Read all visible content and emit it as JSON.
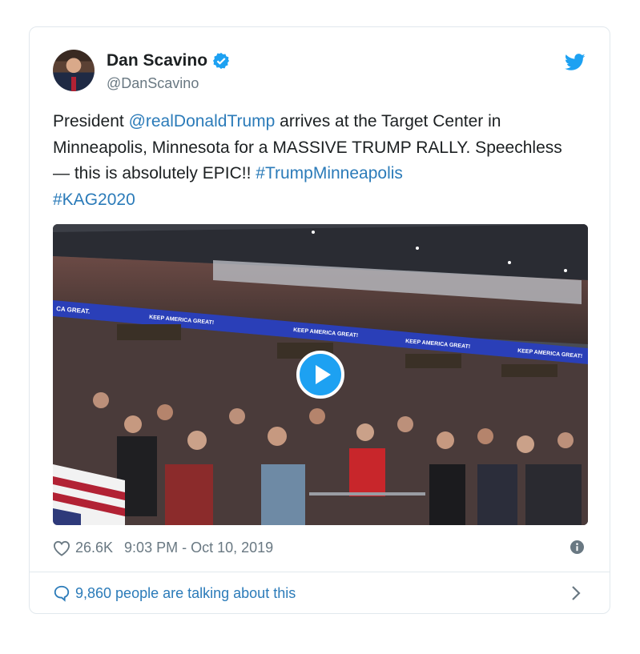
{
  "tweet": {
    "author_name": "Dan Scavino",
    "author_handle": "@DanScavino",
    "text_parts": {
      "p1": "President ",
      "mention": "@realDonaldTrump",
      "p2": " arrives at the Target Center in Minneapolis, Minnesota for a MASSIVE TRUMP RALLY. Speechless — this is absolutely EPIC!! ",
      "hashtag1": "#TrumpMinneapolis",
      "hashtag2": "#KAG2020"
    },
    "likes": "26.6K",
    "timestamp": "9:03 PM - Oct 10, 2019",
    "conversation": "9,860 people are talking about this"
  },
  "video": {
    "banner_texts": [
      "CA GREAT.",
      "KEEP AMERICA GREAT!",
      "KEEP AMERICA GREAT!",
      "KEEP AMERICA GREAT!",
      "KEEP AMERICA GREAT!"
    ]
  },
  "icons": {
    "verified": "verified-badge-icon",
    "brand": "twitter-bird-icon",
    "like": "heart-icon",
    "info": "info-icon",
    "reply": "speech-bubble-icon",
    "more": "chevron-right-icon",
    "play": "play-icon"
  },
  "colors": {
    "link": "#2b7bb9",
    "brand": "#1da1f2",
    "secondary_text": "#697882",
    "border": "#e1e8ed"
  }
}
